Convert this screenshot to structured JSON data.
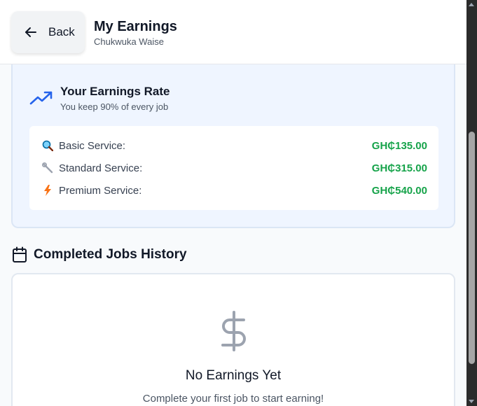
{
  "header": {
    "back_label": "Back",
    "title": "My Earnings",
    "subtitle": "Chukwuka Waise"
  },
  "earnings_rate": {
    "title": "Your Earnings Rate",
    "subtitle": "You keep 90% of every job",
    "icon": "trending-up-icon",
    "items": [
      {
        "icon": "magnifier-icon",
        "label": "Basic Service:",
        "amount": "GH₵135.00"
      },
      {
        "icon": "wrench-icon",
        "label": "Standard Service:",
        "amount": "GH₵315.00"
      },
      {
        "icon": "lightning-icon",
        "label": "Premium Service:",
        "amount": "GH₵540.00"
      }
    ],
    "amount_color": "#16a34a"
  },
  "jobs_history": {
    "title": "Completed Jobs History",
    "icon": "calendar-icon",
    "empty_icon": "dollar-icon",
    "empty_title": "No Earnings Yet",
    "empty_subtitle": "Complete your first job to start earning!"
  },
  "colors": {
    "accent_blue": "#2563eb",
    "card_bg": "#eff5ff",
    "success_green": "#16a34a"
  }
}
